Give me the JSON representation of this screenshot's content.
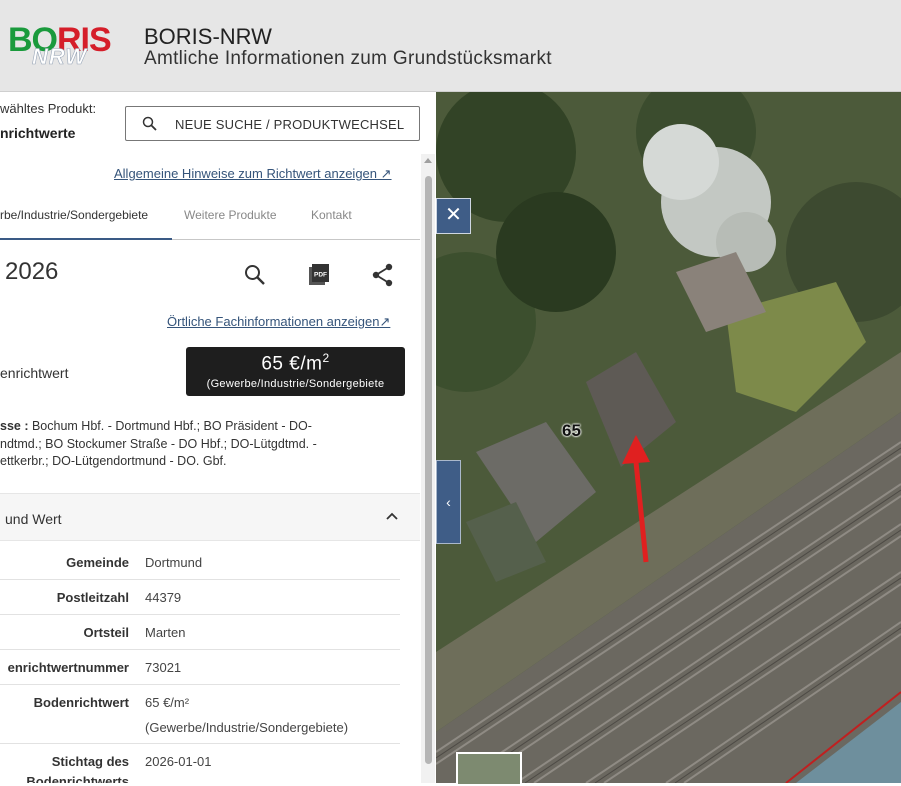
{
  "header": {
    "logo_text_1": "BORIS",
    "logo_text_2": "NRW",
    "title": "BORIS-NRW",
    "subtitle": "Amtliche Informationen zum Grundstücksmarkt"
  },
  "panel": {
    "selected_label": "wähltes Produkt:",
    "selected_value": "nrichtwerte",
    "search_button": "NEUE SUCHE / PRODUKTWECHSEL",
    "general_link": "Allgemeine Hinweise zum Richtwert anzeigen",
    "tabs": [
      {
        "label": "rbe/Industrie/Sondergebiete",
        "active": true
      },
      {
        "label": "Weitere Produkte",
        "active": false
      },
      {
        "label": "Kontakt",
        "active": false
      }
    ],
    "year": "2026",
    "actions": {
      "search_icon": "search-icon",
      "pdf_icon": "pdf-icon",
      "share_icon": "share-icon",
      "pdf_text": "PDF"
    },
    "local_link": "Örtliche Fachinformationen anzeigen",
    "brw_label": "enrichtwert",
    "value_main": "65 €/m",
    "value_sup": "2",
    "value_sub": "(Gewerbe/Industrie/Sondergebiete",
    "zone_label": "sse :",
    "zone_text": " Bochum Hbf. - Dortmund Hbf.; BO Präsident - DO-",
    "zone_line2": "ndtmd.; BO Stockumer Straße - DO Hbf.; DO-Lütgdtmd. -",
    "zone_line3": "ettkerbr.; DO-Lütgendortmund - DO. Gbf.",
    "accordion_label": "und Wert",
    "rows": [
      {
        "key": "Gemeinde",
        "value": "Dortmund"
      },
      {
        "key": "Postleitzahl",
        "value": "44379"
      },
      {
        "key": "Ortsteil",
        "value": "Marten"
      },
      {
        "key": "enrichtwertnummer",
        "value": "73021"
      },
      {
        "key": "Bodenrichtwert",
        "value": "65 €/m²",
        "value2": "(Gewerbe/Industrie/Sondergebiete)"
      },
      {
        "key": "Stichtag des",
        "key2": "Bodenrichtwerts",
        "value": "2026-01-01"
      }
    ]
  },
  "map": {
    "parcel_label": "65",
    "close_symbol": "✕",
    "collapse_symbol": "‹",
    "colors": {
      "accent": "#3f5d87",
      "arrow": "#e02020",
      "link": "#35547a"
    }
  }
}
